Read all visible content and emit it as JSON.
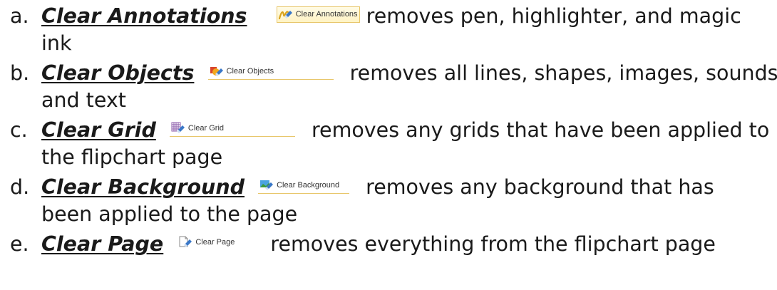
{
  "items": [
    {
      "marker": "a.",
      "term": "Clear Annotations",
      "tool_label": "Clear Annotations",
      "tool_icon": "annotations-eraser-icon",
      "line1_rest": "removes pen, highlighter, and magic",
      "line2": "ink"
    },
    {
      "marker": "b.",
      "term": "Clear Objects",
      "tool_label": "Clear Objects",
      "tool_icon": "objects-eraser-icon",
      "line1_rest": "removes all lines, shapes, images, sounds,",
      "line2": "and text"
    },
    {
      "marker": "c.",
      "term": "Clear Grid",
      "tool_label": "Clear Grid",
      "tool_icon": "grid-eraser-icon",
      "line1_rest": "removes any grids that have been applied to",
      "line2": "the flipchart page"
    },
    {
      "marker": "d.",
      "term": "Clear Background",
      "tool_label": "Clear Background",
      "tool_icon": "background-eraser-icon",
      "line1_rest": "removes any background that has",
      "line2": "been applied to the page"
    },
    {
      "marker": "e.",
      "term": "Clear Page",
      "tool_label": "Clear Page",
      "tool_icon": "page-eraser-icon",
      "line1_rest": "removes everything from the flipchart page",
      "line2": ""
    }
  ],
  "colors": {
    "tool_border": "#e8c66a",
    "eraser_blue": "#3a78c8"
  }
}
